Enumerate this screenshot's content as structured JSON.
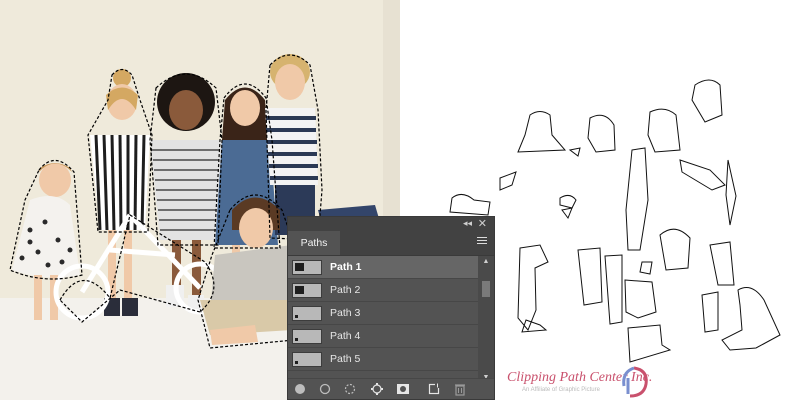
{
  "panel": {
    "tab_label": "Paths",
    "collapse_icon": "collapse-arrows-icon",
    "close_icon": "close-icon",
    "menu_icon": "panel-menu-icon",
    "paths": [
      {
        "label": "Path 1",
        "selected": true
      },
      {
        "label": "Path 2",
        "selected": false
      },
      {
        "label": "Path 3",
        "selected": false
      },
      {
        "label": "Path 4",
        "selected": false
      },
      {
        "label": "Path 5",
        "selected": false
      }
    ],
    "footer_icons": [
      "fill-path-icon",
      "stroke-path-icon",
      "load-as-selection-icon",
      "make-work-path-icon",
      "add-mask-icon",
      "new-path-icon",
      "delete-path-icon"
    ]
  },
  "watermark": {
    "text": "Clipping Path Center Inc.",
    "subtext": "An Affiliate of Graphic Picture",
    "brand_color": "#c9516d"
  }
}
